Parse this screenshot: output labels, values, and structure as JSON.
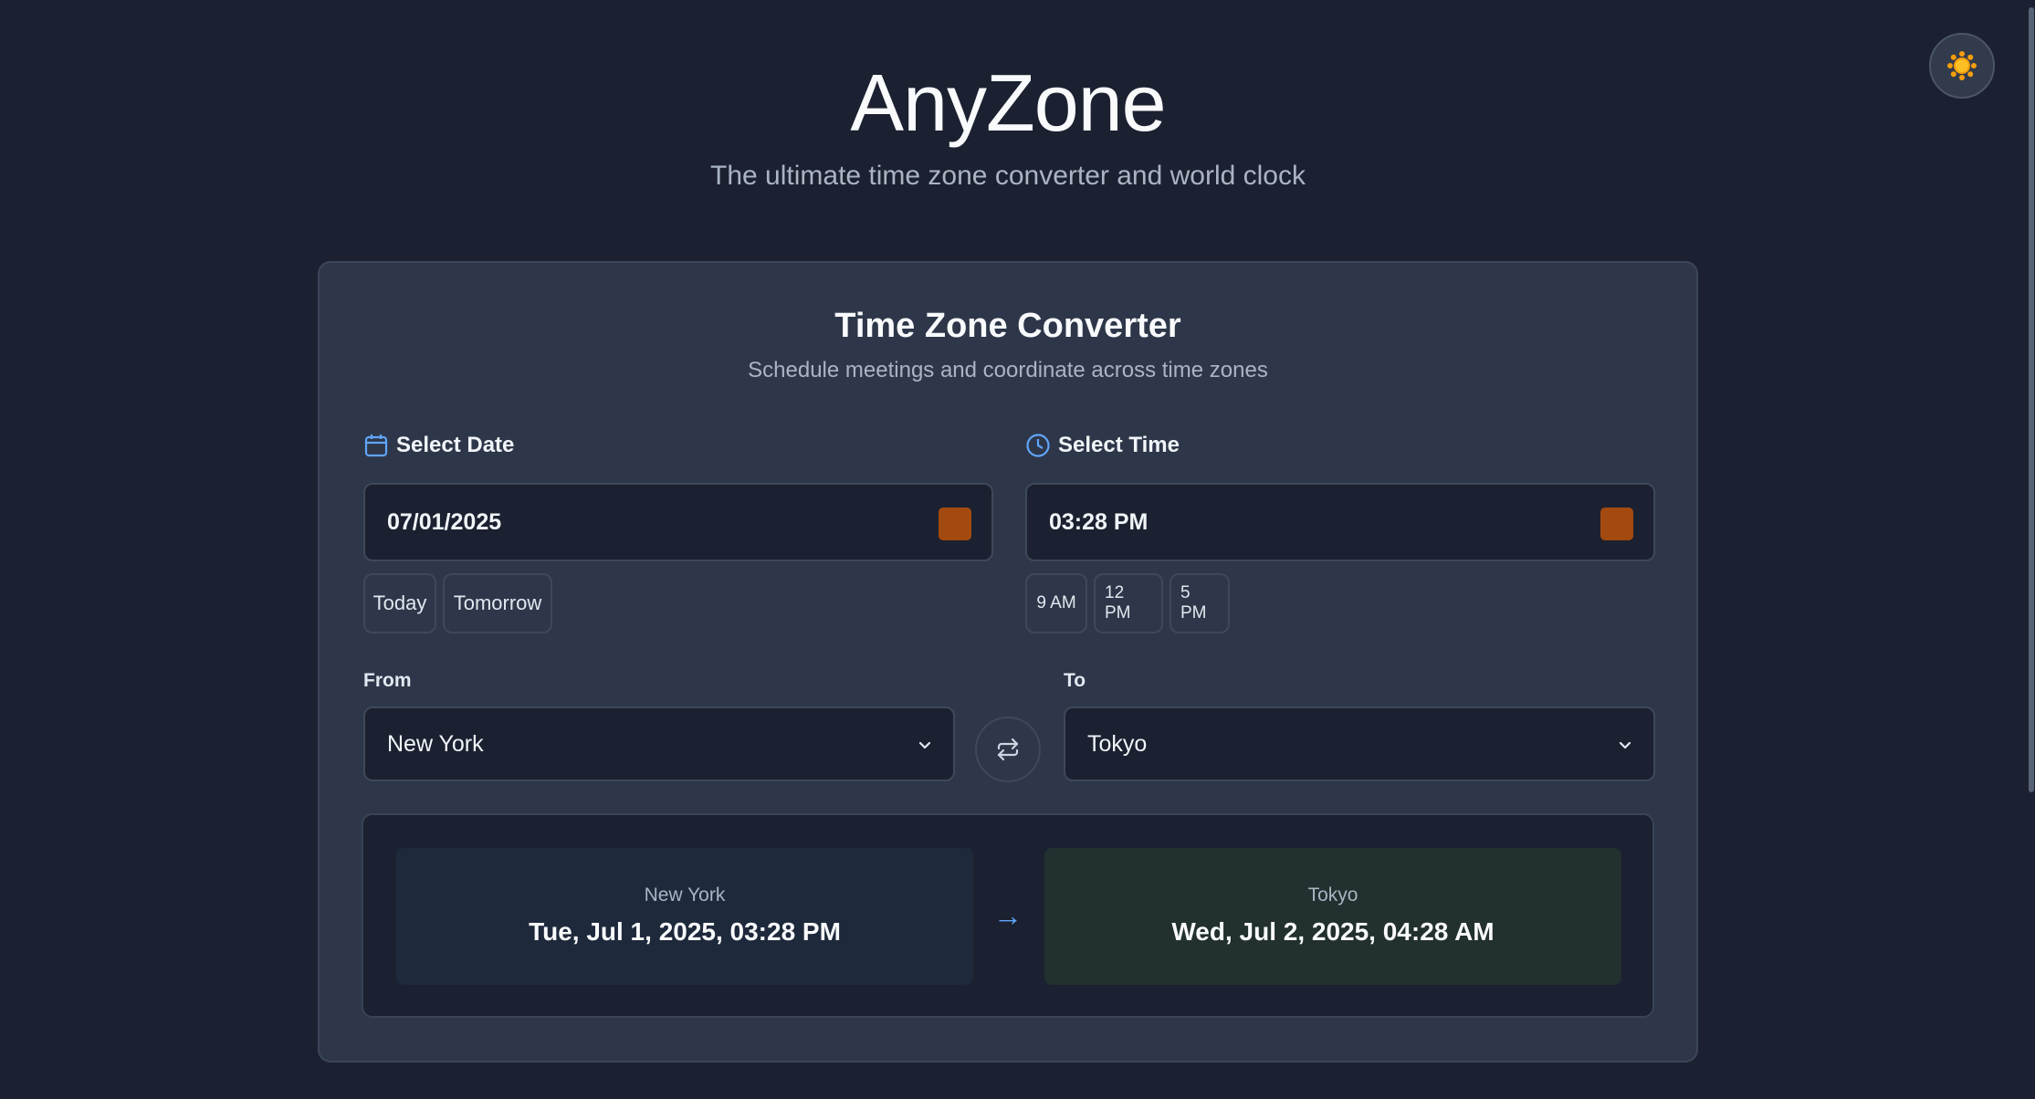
{
  "app": {
    "title": "AnyZone",
    "subtitle": "The ultimate time zone converter and world clock"
  },
  "theme_toggle": {
    "icon": "sun-icon",
    "color": "#f59e0b"
  },
  "converter": {
    "title": "Time Zone Converter",
    "subtitle": "Schedule meetings and coordinate across time zones",
    "date": {
      "label": "Select Date",
      "value": "07/01/2025",
      "quick": [
        "Today",
        "Tomorrow"
      ]
    },
    "time": {
      "label": "Select Time",
      "value": "03:28 PM",
      "quick": [
        "9 AM",
        "12 PM",
        "5 PM"
      ]
    },
    "from": {
      "label": "From",
      "selected": "New York"
    },
    "to": {
      "label": "To",
      "selected": "Tokyo"
    },
    "result": {
      "from_city": "New York",
      "from_time": "Tue, Jul 1, 2025, 03:28 PM",
      "arrow": "→",
      "to_city": "Tokyo",
      "to_time": "Wed, Jul 2, 2025, 04:28 AM"
    }
  },
  "colors": {
    "background": "#1b2130",
    "card": "#2e3749",
    "accent_blue": "#60a5fa",
    "picker_orange": "#a34a10"
  }
}
